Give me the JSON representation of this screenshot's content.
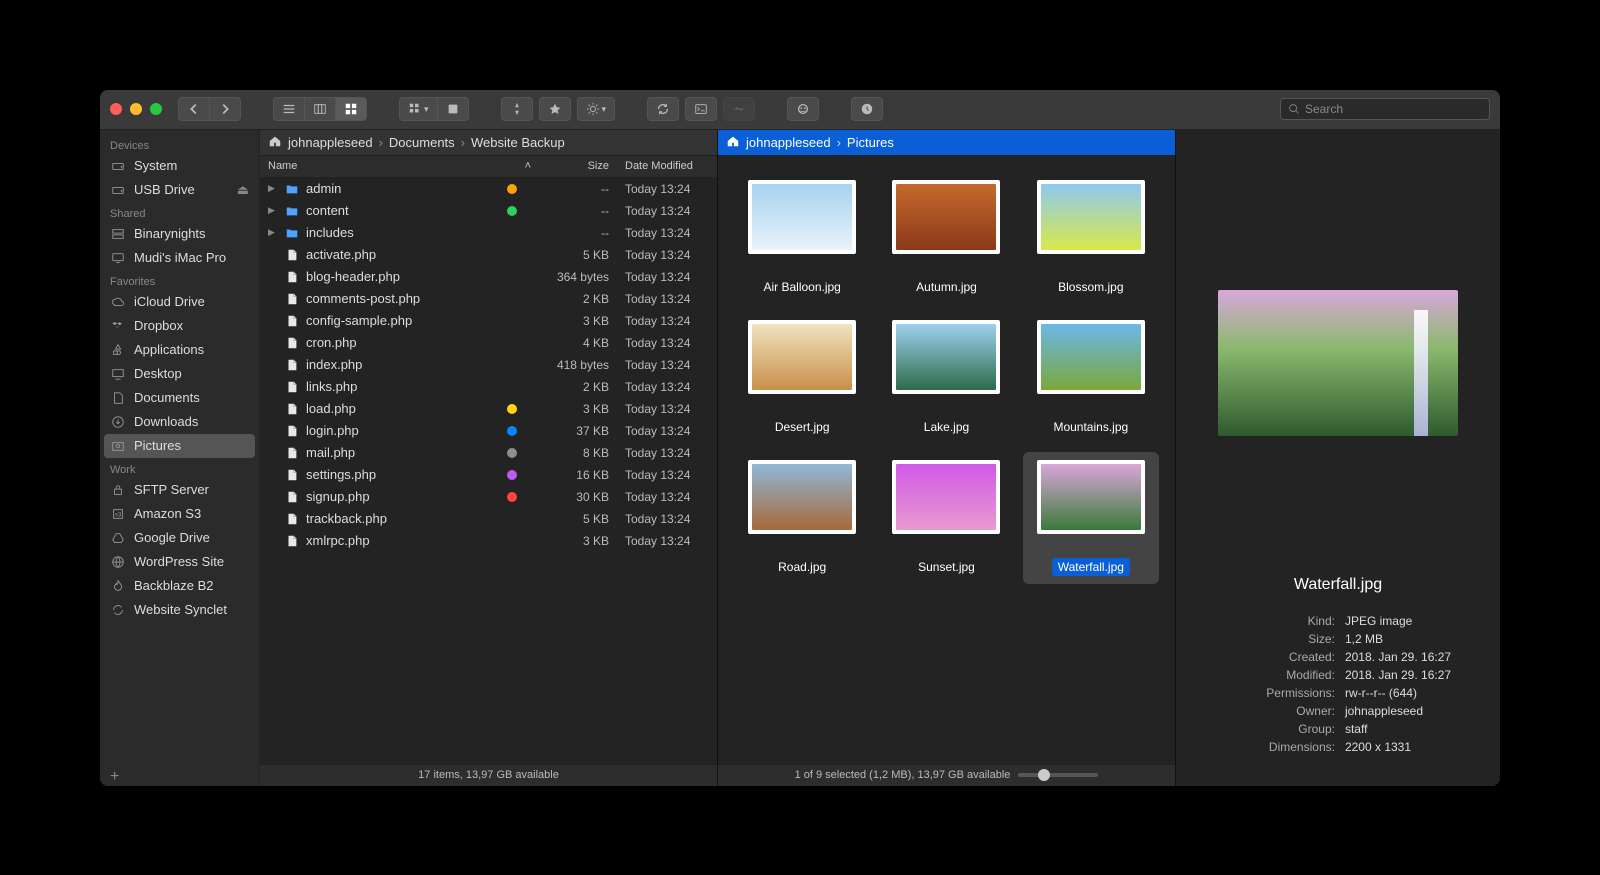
{
  "search": {
    "placeholder": "Search"
  },
  "sidebar": {
    "sections": [
      {
        "heading": "Devices",
        "items": [
          {
            "label": "System",
            "icon": "hdd"
          },
          {
            "label": "USB Drive",
            "icon": "hdd",
            "eject": true
          }
        ]
      },
      {
        "heading": "Shared",
        "items": [
          {
            "label": "Binarynights",
            "icon": "server"
          },
          {
            "label": "Mudi's iMac Pro",
            "icon": "display"
          }
        ]
      },
      {
        "heading": "Favorites",
        "items": [
          {
            "label": "iCloud Drive",
            "icon": "cloud"
          },
          {
            "label": "Dropbox",
            "icon": "dropbox"
          },
          {
            "label": "Applications",
            "icon": "apps"
          },
          {
            "label": "Desktop",
            "icon": "desktop"
          },
          {
            "label": "Documents",
            "icon": "doc"
          },
          {
            "label": "Downloads",
            "icon": "download"
          },
          {
            "label": "Pictures",
            "icon": "pictures",
            "selected": true
          }
        ]
      },
      {
        "heading": "Work",
        "items": [
          {
            "label": "SFTP Server",
            "icon": "lock"
          },
          {
            "label": "Amazon S3",
            "icon": "s3"
          },
          {
            "label": "Google Drive",
            "icon": "gdrive"
          },
          {
            "label": "WordPress Site",
            "icon": "globe"
          },
          {
            "label": "Backblaze B2",
            "icon": "flame"
          },
          {
            "label": "Website Synclet",
            "icon": "sync"
          }
        ]
      }
    ]
  },
  "left": {
    "breadcrumb": [
      "johnappleseed",
      "Documents",
      "Website Backup"
    ],
    "columns": {
      "name": "Name",
      "size": "Size",
      "date": "Date Modified"
    },
    "files": [
      {
        "name": "admin",
        "type": "folder",
        "size": "--",
        "date": "Today 13:24",
        "tag": "#ff9f0a",
        "disclose": true
      },
      {
        "name": "content",
        "type": "folder",
        "size": "--",
        "date": "Today 13:24",
        "tag": "#30d158",
        "disclose": true
      },
      {
        "name": "includes",
        "type": "folder",
        "size": "--",
        "date": "Today 13:24",
        "disclose": true
      },
      {
        "name": "activate.php",
        "type": "file",
        "size": "5 KB",
        "date": "Today 13:24"
      },
      {
        "name": "blog-header.php",
        "type": "file",
        "size": "364 bytes",
        "date": "Today 13:24"
      },
      {
        "name": "comments-post.php",
        "type": "file",
        "size": "2 KB",
        "date": "Today 13:24"
      },
      {
        "name": "config-sample.php",
        "type": "file",
        "size": "3 KB",
        "date": "Today 13:24"
      },
      {
        "name": "cron.php",
        "type": "file",
        "size": "4 KB",
        "date": "Today 13:24"
      },
      {
        "name": "index.php",
        "type": "file",
        "size": "418 bytes",
        "date": "Today 13:24"
      },
      {
        "name": "links.php",
        "type": "file",
        "size": "2 KB",
        "date": "Today 13:24"
      },
      {
        "name": "load.php",
        "type": "file",
        "size": "3 KB",
        "date": "Today 13:24",
        "tag": "#ffd60a"
      },
      {
        "name": "login.php",
        "type": "file",
        "size": "37 KB",
        "date": "Today 13:24",
        "tag": "#0a84ff"
      },
      {
        "name": "mail.php",
        "type": "file",
        "size": "8 KB",
        "date": "Today 13:24",
        "tag": "#8e8e93"
      },
      {
        "name": "settings.php",
        "type": "file",
        "size": "16 KB",
        "date": "Today 13:24",
        "tag": "#bf5af2"
      },
      {
        "name": "signup.php",
        "type": "file",
        "size": "30 KB",
        "date": "Today 13:24",
        "tag": "#ff453a"
      },
      {
        "name": "trackback.php",
        "type": "file",
        "size": "5 KB",
        "date": "Today 13:24"
      },
      {
        "name": "xmlrpc.php",
        "type": "file",
        "size": "3 KB",
        "date": "Today 13:24"
      }
    ],
    "status": "17 items, 13,97 GB available"
  },
  "right": {
    "breadcrumb": [
      "johnappleseed",
      "Pictures"
    ],
    "items": [
      {
        "name": "Air Balloon.jpg",
        "gradient": "linear-gradient(180deg,#a7d3f0,#e8f2fa)"
      },
      {
        "name": "Autumn.jpg",
        "gradient": "linear-gradient(180deg,#c46a2e,#8a3a1a)"
      },
      {
        "name": "Blossom.jpg",
        "gradient": "linear-gradient(180deg,#8ec9f0,#d9e84a)"
      },
      {
        "name": "Desert.jpg",
        "gradient": "linear-gradient(180deg,#f0e3c0,#c98f4a)"
      },
      {
        "name": "Lake.jpg",
        "gradient": "linear-gradient(180deg,#9fd0f0,#2e6b4a)"
      },
      {
        "name": "Mountains.jpg",
        "gradient": "linear-gradient(180deg,#6bb7e8,#7aa83a)"
      },
      {
        "name": "Road.jpg",
        "gradient": "linear-gradient(180deg,#8fb8d6,#a66a3a)"
      },
      {
        "name": "Sunset.jpg",
        "gradient": "linear-gradient(180deg,#d05ae8,#e89ad0)"
      },
      {
        "name": "Waterfall.jpg",
        "gradient": "linear-gradient(180deg,#d9a7d9,#3a7a3a)",
        "selected": true
      }
    ],
    "status": "1 of 9 selected (1,2 MB), 13,97 GB available"
  },
  "preview": {
    "title": "Waterfall.jpg",
    "rows": [
      {
        "k": "Kind:",
        "v": "JPEG image"
      },
      {
        "k": "Size:",
        "v": "1,2 MB"
      },
      {
        "k": "Created:",
        "v": "2018. Jan 29. 16:27"
      },
      {
        "k": "Modified:",
        "v": "2018. Jan 29. 16:27"
      },
      {
        "k": "Permissions:",
        "v": "rw-r--r-- (644)"
      },
      {
        "k": "Owner:",
        "v": "johnappleseed"
      },
      {
        "k": "Group:",
        "v": "staff"
      },
      {
        "k": "Dimensions:",
        "v": "2200 x 1331"
      }
    ]
  }
}
